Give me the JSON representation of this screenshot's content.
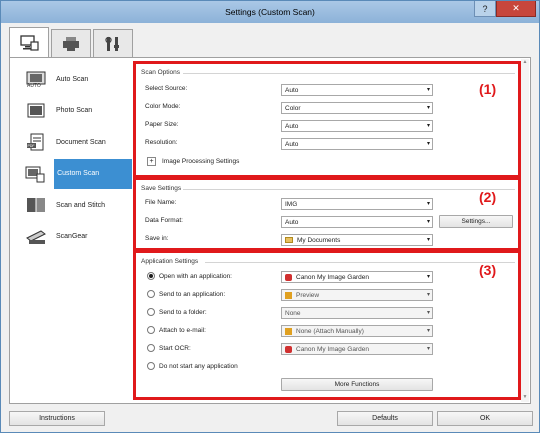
{
  "window": {
    "title": "Settings (Custom Scan)",
    "help_label": "?",
    "close_label": "✕"
  },
  "tabs": [
    {
      "icon": "scan-from-computer-icon"
    },
    {
      "icon": "scan-from-panel-icon"
    },
    {
      "icon": "general-settings-icon"
    }
  ],
  "sidebar": {
    "items": [
      {
        "label": "Auto Scan",
        "icon": "auto-scan-icon"
      },
      {
        "label": "Photo Scan",
        "icon": "photo-scan-icon"
      },
      {
        "label": "Document Scan",
        "icon": "document-scan-icon"
      },
      {
        "label": "Custom Scan",
        "icon": "custom-scan-icon",
        "active": true
      },
      {
        "label": "Scan and Stitch",
        "icon": "scan-and-stitch-icon"
      },
      {
        "label": "ScanGear",
        "icon": "scangear-icon"
      }
    ]
  },
  "scan_options": {
    "title": "Scan Options",
    "marker": "(1)",
    "select_source": {
      "label": "Select Source:",
      "value": "Auto"
    },
    "color_mode": {
      "label": "Color Mode:",
      "value": "Color"
    },
    "paper_size": {
      "label": "Paper Size:",
      "value": "Auto"
    },
    "resolution": {
      "label": "Resolution:",
      "value": "Auto"
    },
    "image_processing": {
      "label": "Image Processing Settings",
      "toggle": "+"
    }
  },
  "save_settings": {
    "title": "Save Settings",
    "marker": "(2)",
    "file_name": {
      "label": "File Name:",
      "value": "IMG"
    },
    "data_format": {
      "label": "Data Format:",
      "value": "Auto",
      "button": "Settings..."
    },
    "save_in": {
      "label": "Save in:",
      "value": "My Documents"
    }
  },
  "application_settings": {
    "title": "Application Settings",
    "marker": "(3)",
    "open_app": {
      "label": "Open with an application:",
      "value": "Canon My Image Garden",
      "selected": true
    },
    "send_app": {
      "label": "Send to an application:",
      "value": "Preview"
    },
    "send_folder": {
      "label": "Send to a folder:",
      "value": "None"
    },
    "attach_email": {
      "label": "Attach to e-mail:",
      "value": "None (Attach Manually)"
    },
    "start_ocr": {
      "label": "Start OCR:",
      "value": "Canon My Image Garden"
    },
    "no_app": {
      "label": "Do not start any application"
    },
    "more_functions": "More Functions"
  },
  "footer": {
    "instructions": "Instructions",
    "defaults": "Defaults",
    "ok": "OK"
  },
  "colors": {
    "accent": "#3c8fd2",
    "marker": "#e0191b"
  }
}
